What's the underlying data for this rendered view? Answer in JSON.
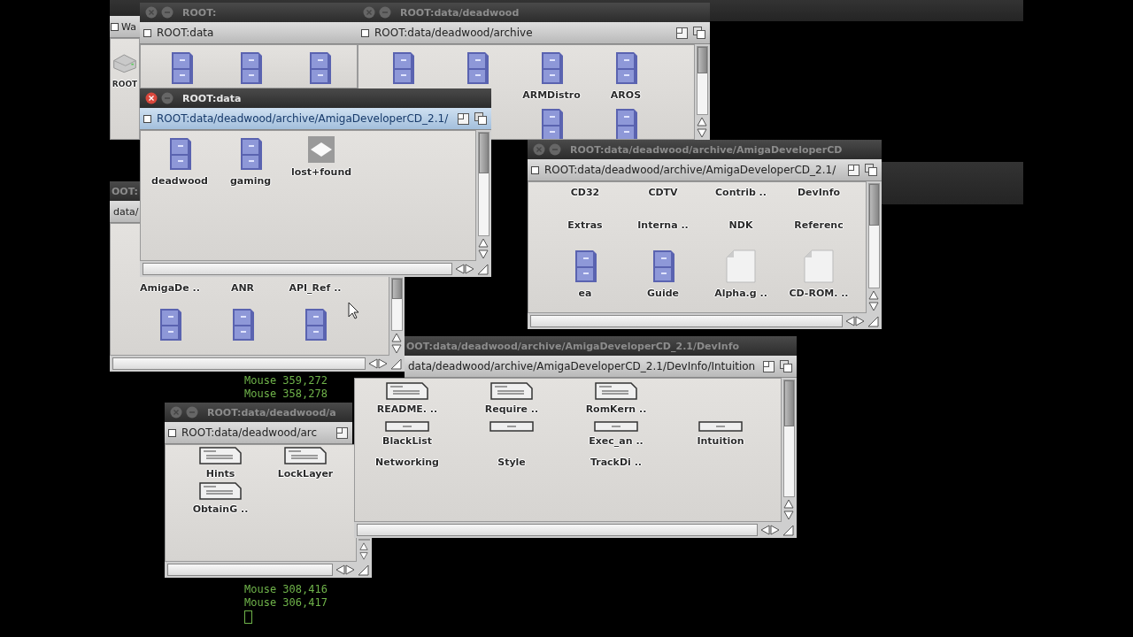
{
  "desktop": {
    "windows": [
      {
        "active": false,
        "path": "Wa",
        "items": [
          {
            "kind": "drive",
            "label": "ROOT"
          }
        ]
      },
      {
        "active": false,
        "title": "ROOT:",
        "path": "ROOT:data",
        "items": [
          {
            "kind": "drawer"
          },
          {
            "kind": "drawer"
          },
          {
            "kind": "drawer"
          }
        ]
      },
      {
        "active": false,
        "title": "ROOT:data/deadwood",
        "path": "ROOT:data/deadwood/archive",
        "items": [
          {
            "kind": "drawer"
          },
          {
            "kind": "drawer"
          },
          {
            "kind": "drawer",
            "label": "ARMDistro"
          },
          {
            "kind": "drawer",
            "label": "AROS"
          },
          {
            "kind": "drawer"
          },
          {
            "kind": "drawer"
          }
        ]
      },
      {
        "active": false,
        "title": "ROOT:data/deadwood/a",
        "path": "ROOT:data/deadwood/arc",
        "items": [
          {
            "kind": "textdoc",
            "label": "Hints"
          },
          {
            "kind": "textdoc",
            "label": "LockLayer"
          },
          {
            "kind": "textdoc",
            "label": "ObtainG .."
          }
        ]
      },
      {
        "active": false,
        "title": "OOT:data/deadwood/archive/AmigaDeveloperCD_2.1/DevInfo",
        "path": "data/deadwood/archive/AmigaDeveloperCD_2.1/DevInfo/Intuition",
        "items": [
          {
            "kind": "textdoc",
            "label": "README. .."
          },
          {
            "kind": "textdoc",
            "label": "Require .."
          },
          {
            "kind": "textdoc",
            "label": "RomKern .."
          },
          {
            "kind": "none"
          },
          {
            "kind": "button",
            "label": "BlackList"
          },
          {
            "kind": "button"
          },
          {
            "kind": "button",
            "label": "Exec_an .."
          },
          {
            "kind": "button",
            "label": "Intuition"
          },
          {
            "kind": "none",
            "label": "Networking"
          },
          {
            "kind": "none",
            "label": "Style"
          },
          {
            "kind": "none",
            "label": "TrackDi .."
          }
        ]
      },
      {
        "active": false,
        "title": "OOT:",
        "path": "data/",
        "items": [
          {
            "kind": "none",
            "label": "AmigaDe .."
          },
          {
            "kind": "none",
            "label": "ANR"
          },
          {
            "kind": "none",
            "label": "API_Ref .."
          },
          {
            "kind": "drawer"
          },
          {
            "kind": "drawer"
          },
          {
            "kind": "drawer"
          }
        ]
      },
      {
        "active": true,
        "title": "ROOT:data",
        "path": "ROOT:data/deadwood/archive/AmigaDeveloperCD_2.1/",
        "items": [
          {
            "kind": "drawer",
            "label": "deadwood"
          },
          {
            "kind": "drawer",
            "label": "gaming"
          },
          {
            "kind": "disk",
            "label": "lost+found"
          }
        ]
      },
      {
        "active": false,
        "title": "ROOT:data/deadwood/archive/AmigaDeveloperCD",
        "path": "ROOT:data/deadwood/archive/AmigaDeveloperCD_2.1/",
        "items": [
          {
            "kind": "none",
            "label": "CD32"
          },
          {
            "kind": "none",
            "label": "CDTV"
          },
          {
            "kind": "none",
            "label": "Contrib .."
          },
          {
            "kind": "none",
            "label": "DevInfo"
          },
          {
            "kind": "none",
            "label": "Extras"
          },
          {
            "kind": "none",
            "label": "Interna .."
          },
          {
            "kind": "none",
            "label": "NDK"
          },
          {
            "kind": "none",
            "label": "Referenc"
          },
          {
            "kind": "drawer",
            "label": "ea"
          },
          {
            "kind": "drawer",
            "label": "Guide"
          },
          {
            "kind": "file",
            "label": "Alpha.g .."
          },
          {
            "kind": "file",
            "label": "CD-ROM. .."
          }
        ]
      }
    ]
  },
  "terminal": {
    "upper_lines": [
      "Mouse 359,272",
      "Mouse 358,278"
    ],
    "lower_lines": [
      "Mouse 308,416",
      "Mouse 306,417"
    ]
  }
}
